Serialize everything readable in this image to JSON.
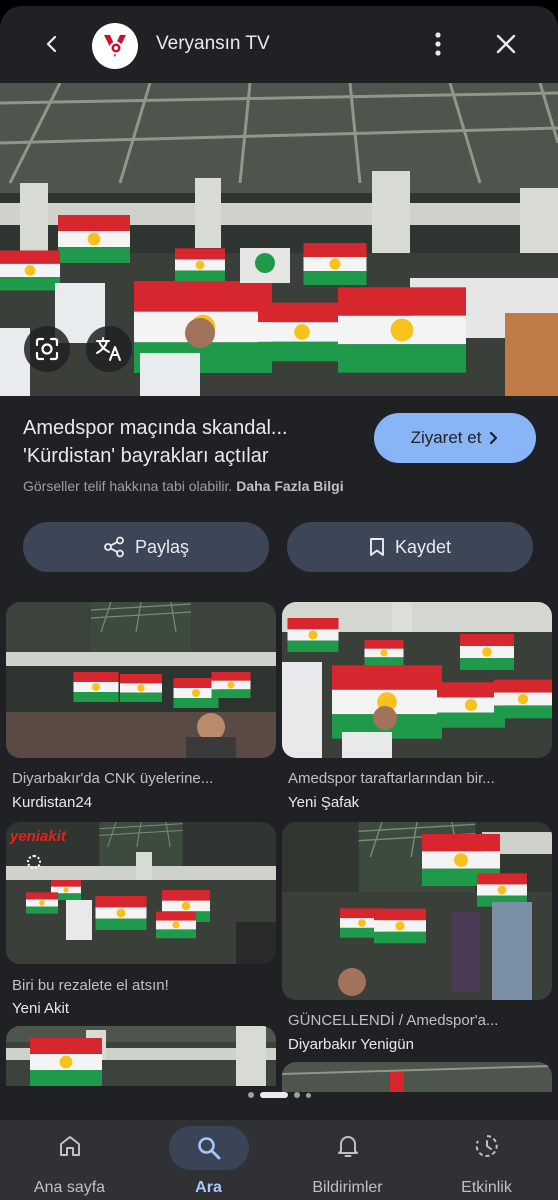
{
  "header": {
    "site_name": "Veryansın TV",
    "logo_icon": "veryansin-logo",
    "colors": {
      "logo_red": "#c8102e"
    }
  },
  "result": {
    "title": "Amedspor maçında skandal... 'Kürdistan' bayrakları açtılar",
    "visit_label": "Ziyaret et",
    "copyright_text": "Görseller telif hakkına tabi olabilir.",
    "more_info_label": "Daha Fazla Bilgi",
    "share_label": "Paylaş",
    "save_label": "Kaydet",
    "accent": "#8ab4f8"
  },
  "related": [
    {
      "caption": "Diyarbakır'da CNK üyelerine...",
      "source": "Kurdistan24"
    },
    {
      "caption": "Amedspor taraftarlarından bir...",
      "source": "Yeni Şafak"
    },
    {
      "caption": "Biri bu rezalete el atsın!",
      "source": "Yeni Akit",
      "badge": "yeniakit"
    },
    {
      "caption": "GÜNCELLENDİ / Amedspor'a...",
      "source": "Diyarbakır Yenigün"
    }
  ],
  "nav": {
    "items": [
      {
        "label": "Ana sayfa",
        "icon": "home-icon"
      },
      {
        "label": "Ara",
        "icon": "search-icon",
        "active": true
      },
      {
        "label": "Bildirimler",
        "icon": "bell-icon"
      },
      {
        "label": "Etkinlik",
        "icon": "activity-icon"
      }
    ]
  }
}
